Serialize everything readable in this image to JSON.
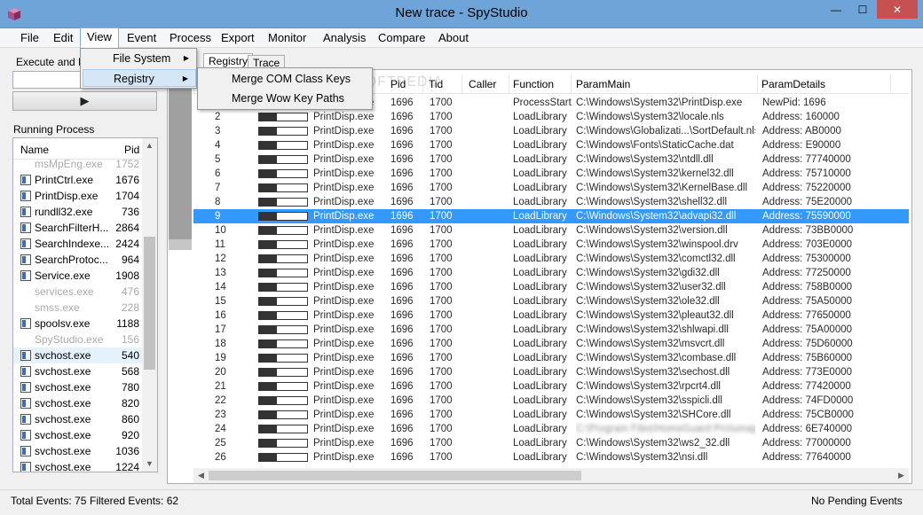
{
  "window": {
    "title": "New trace - SpyStudio",
    "minimize": "—",
    "maximize": "☐",
    "close": "✕"
  },
  "menu": [
    "File",
    "Edit",
    "View",
    "Event",
    "Process",
    "Export",
    "Monitor",
    "Analysis",
    "Compare",
    "About"
  ],
  "view_menu": {
    "items": [
      "File System",
      "Registry"
    ]
  },
  "registry_submenu": {
    "items": [
      "Merge COM Class Keys",
      "Merge Wow Key Paths"
    ]
  },
  "left": {
    "exec_label": "Execute and Hook",
    "run_icon": "▶",
    "running_label": "Running Process",
    "columns": {
      "name": "Name",
      "pid": "Pid"
    },
    "processes": [
      {
        "name": "msMpEng.exe",
        "pid": "1752",
        "dim": true
      },
      {
        "name": "PrintCtrl.exe",
        "pid": "1676"
      },
      {
        "name": "PrintDisp.exe",
        "pid": "1704"
      },
      {
        "name": "rundll32.exe",
        "pid": "736"
      },
      {
        "name": "SearchFilterH...",
        "pid": "2864"
      },
      {
        "name": "SearchIndexe...",
        "pid": "2424"
      },
      {
        "name": "SearchProtoc...",
        "pid": "964"
      },
      {
        "name": "Service.exe",
        "pid": "1908"
      },
      {
        "name": "services.exe",
        "pid": "476",
        "dim": true
      },
      {
        "name": "smss.exe",
        "pid": "228",
        "dim": true
      },
      {
        "name": "spoolsv.exe",
        "pid": "1188"
      },
      {
        "name": "SpyStudio.exe",
        "pid": "156",
        "dim": true
      },
      {
        "name": "svchost.exe",
        "pid": "540",
        "sel": true
      },
      {
        "name": "svchost.exe",
        "pid": "568"
      },
      {
        "name": "svchost.exe",
        "pid": "780"
      },
      {
        "name": "svchost.exe",
        "pid": "820"
      },
      {
        "name": "svchost.exe",
        "pid": "860"
      },
      {
        "name": "svchost.exe",
        "pid": "920"
      },
      {
        "name": "svchost.exe",
        "pid": "1036"
      },
      {
        "name": "svchost.exe",
        "pid": "1224"
      }
    ]
  },
  "tabs": [
    "Registry",
    "Trace"
  ],
  "grid": {
    "columns": [
      "Pid",
      "Tid",
      "Caller",
      "Function",
      "ParamMain",
      "ParamDetails"
    ],
    "rows": [
      {
        "n": "1",
        "proc": "PrintDisp.exe",
        "pid": "1696",
        "tid": "1700",
        "fn": "ProcessStarted",
        "main": "C:\\Windows\\System32\\PrintDisp.exe",
        "det": "NewPid: 1696"
      },
      {
        "n": "2",
        "proc": "PrintDisp.exe",
        "pid": "1696",
        "tid": "1700",
        "fn": "LoadLibrary",
        "main": "C:\\Windows\\System32\\locale.nls",
        "det": "Address: 160000"
      },
      {
        "n": "3",
        "proc": "PrintDisp.exe",
        "pid": "1696",
        "tid": "1700",
        "fn": "LoadLibrary",
        "main": "C:\\Windows\\Globalizati...\\SortDefault.nls",
        "det": "Address: AB0000"
      },
      {
        "n": "4",
        "proc": "PrintDisp.exe",
        "pid": "1696",
        "tid": "1700",
        "fn": "LoadLibrary",
        "main": "C:\\Windows\\Fonts\\StaticCache.dat",
        "det": "Address: E90000"
      },
      {
        "n": "5",
        "proc": "PrintDisp.exe",
        "pid": "1696",
        "tid": "1700",
        "fn": "LoadLibrary",
        "main": "C:\\Windows\\System32\\ntdll.dll",
        "det": "Address: 77740000"
      },
      {
        "n": "6",
        "proc": "PrintDisp.exe",
        "pid": "1696",
        "tid": "1700",
        "fn": "LoadLibrary",
        "main": "C:\\Windows\\System32\\kernel32.dll",
        "det": "Address: 75710000"
      },
      {
        "n": "7",
        "proc": "PrintDisp.exe",
        "pid": "1696",
        "tid": "1700",
        "fn": "LoadLibrary",
        "main": "C:\\Windows\\System32\\KernelBase.dll",
        "det": "Address: 75220000"
      },
      {
        "n": "8",
        "proc": "PrintDisp.exe",
        "pid": "1696",
        "tid": "1700",
        "fn": "LoadLibrary",
        "main": "C:\\Windows\\System32\\shell32.dll",
        "det": "Address: 75E20000"
      },
      {
        "n": "9",
        "proc": "PrintDisp.exe",
        "pid": "1696",
        "tid": "1700",
        "fn": "LoadLibrary",
        "main": "C:\\Windows\\System32\\advapi32.dll",
        "det": "Address: 75590000",
        "sel": true
      },
      {
        "n": "10",
        "proc": "PrintDisp.exe",
        "pid": "1696",
        "tid": "1700",
        "fn": "LoadLibrary",
        "main": "C:\\Windows\\System32\\version.dll",
        "det": "Address: 73BB0000"
      },
      {
        "n": "11",
        "proc": "PrintDisp.exe",
        "pid": "1696",
        "tid": "1700",
        "fn": "LoadLibrary",
        "main": "C:\\Windows\\System32\\winspool.drv",
        "det": "Address: 703E0000"
      },
      {
        "n": "12",
        "proc": "PrintDisp.exe",
        "pid": "1696",
        "tid": "1700",
        "fn": "LoadLibrary",
        "main": "C:\\Windows\\System32\\comctl32.dll",
        "det": "Address: 75300000"
      },
      {
        "n": "13",
        "proc": "PrintDisp.exe",
        "pid": "1696",
        "tid": "1700",
        "fn": "LoadLibrary",
        "main": "C:\\Windows\\System32\\gdi32.dll",
        "det": "Address: 77250000"
      },
      {
        "n": "14",
        "proc": "PrintDisp.exe",
        "pid": "1696",
        "tid": "1700",
        "fn": "LoadLibrary",
        "main": "C:\\Windows\\System32\\user32.dll",
        "det": "Address: 758B0000"
      },
      {
        "n": "15",
        "proc": "PrintDisp.exe",
        "pid": "1696",
        "tid": "1700",
        "fn": "LoadLibrary",
        "main": "C:\\Windows\\System32\\ole32.dll",
        "det": "Address: 75A50000"
      },
      {
        "n": "16",
        "proc": "PrintDisp.exe",
        "pid": "1696",
        "tid": "1700",
        "fn": "LoadLibrary",
        "main": "C:\\Windows\\System32\\pleaut32.dll",
        "det": "Address: 77650000"
      },
      {
        "n": "17",
        "proc": "PrintDisp.exe",
        "pid": "1696",
        "tid": "1700",
        "fn": "LoadLibrary",
        "main": "C:\\Windows\\System32\\shlwapi.dll",
        "det": "Address: 75A00000"
      },
      {
        "n": "18",
        "proc": "PrintDisp.exe",
        "pid": "1696",
        "tid": "1700",
        "fn": "LoadLibrary",
        "main": "C:\\Windows\\System32\\msvcrt.dll",
        "det": "Address: 75D60000"
      },
      {
        "n": "19",
        "proc": "PrintDisp.exe",
        "pid": "1696",
        "tid": "1700",
        "fn": "LoadLibrary",
        "main": "C:\\Windows\\System32\\combase.dll",
        "det": "Address: 75B60000"
      },
      {
        "n": "20",
        "proc": "PrintDisp.exe",
        "pid": "1696",
        "tid": "1700",
        "fn": "LoadLibrary",
        "main": "C:\\Windows\\System32\\sechost.dll",
        "det": "Address: 773E0000"
      },
      {
        "n": "21",
        "proc": "PrintDisp.exe",
        "pid": "1696",
        "tid": "1700",
        "fn": "LoadLibrary",
        "main": "C:\\Windows\\System32\\rpcrt4.dll",
        "det": "Address: 77420000"
      },
      {
        "n": "22",
        "proc": "PrintDisp.exe",
        "pid": "1696",
        "tid": "1700",
        "fn": "LoadLibrary",
        "main": "C:\\Windows\\System32\\sspicli.dll",
        "det": "Address: 74FD0000"
      },
      {
        "n": "23",
        "proc": "PrintDisp.exe",
        "pid": "1696",
        "tid": "1700",
        "fn": "LoadLibrary",
        "main": "C:\\Windows\\System32\\SHCore.dll",
        "det": "Address: 75CB0000"
      },
      {
        "n": "24",
        "proc": "PrintDisp.exe",
        "pid": "1696",
        "tid": "1700",
        "fn": "LoadLibrary",
        "main": "C:\\Program Files\\HomeGuard Pro\\umap.dll",
        "det": "Address: 6E740000",
        "blur": true
      },
      {
        "n": "25",
        "proc": "PrintDisp.exe",
        "pid": "1696",
        "tid": "1700",
        "fn": "LoadLibrary",
        "main": "C:\\Windows\\System32\\ws2_32.dll",
        "det": "Address: 77000000"
      },
      {
        "n": "26",
        "proc": "PrintDisp.exe",
        "pid": "1696",
        "tid": "1700",
        "fn": "LoadLibrary",
        "main": "C:\\Windows\\System32\\nsi.dll",
        "det": "Address: 77640000"
      }
    ]
  },
  "status": {
    "total": "Total Events: 75",
    "filtered": "Filtered Events: 62",
    "pending": "No Pending Events"
  },
  "watermark": "SOFTPEDIA"
}
